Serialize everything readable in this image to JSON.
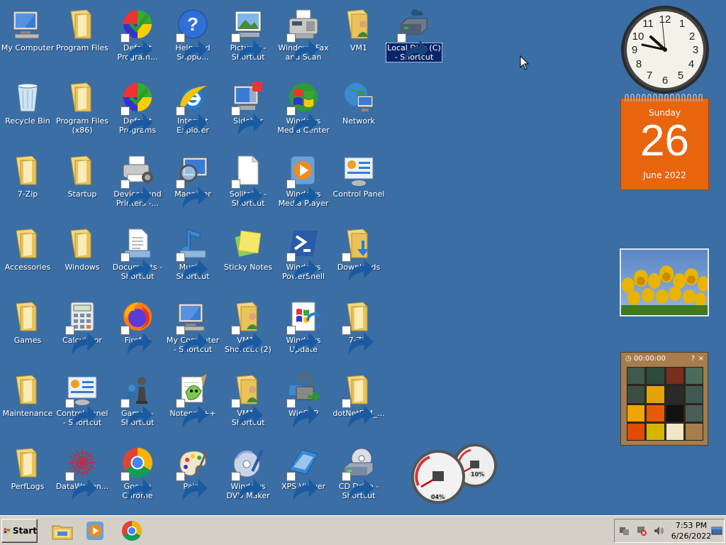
{
  "desktop": {
    "icons": [
      {
        "label": "My Computer",
        "icon": "computer-icon",
        "shortcut": false
      },
      {
        "label": "Program Files",
        "icon": "folder-icon",
        "shortcut": false
      },
      {
        "label": "Default Program...",
        "icon": "default-programs-icon",
        "shortcut": true
      },
      {
        "label": "Help and Suppo...",
        "icon": "help-icon",
        "shortcut": true
      },
      {
        "label": "Pictures - Shortcut",
        "icon": "pictures-icon",
        "shortcut": true
      },
      {
        "label": "Windows Fax and Scan",
        "icon": "fax-icon",
        "shortcut": true
      },
      {
        "label": "VM1",
        "icon": "user-folder-icon",
        "shortcut": false
      },
      {
        "label": "Local Disk (C) - Shortcut",
        "icon": "drive-icon",
        "shortcut": true,
        "selected": true
      },
      {
        "label": "Recycle Bin",
        "icon": "recycle-bin-icon",
        "shortcut": false
      },
      {
        "label": "Program Files (x86)",
        "icon": "folder-icon",
        "shortcut": false
      },
      {
        "label": "Default Programs",
        "icon": "default-programs-icon",
        "shortcut": true
      },
      {
        "label": "Internet Explorer",
        "icon": "internet-explorer-icon",
        "shortcut": true
      },
      {
        "label": "Sidebar",
        "icon": "sidebar-icon",
        "shortcut": true
      },
      {
        "label": "Windows Media Center",
        "icon": "media-center-icon",
        "shortcut": true
      },
      {
        "label": "Network",
        "icon": "network-icon",
        "shortcut": false
      },
      {
        "label": "7-Zip",
        "icon": "folder-icon",
        "shortcut": false
      },
      {
        "label": "Startup",
        "icon": "folder-icon",
        "shortcut": false
      },
      {
        "label": "Devices and Printers -...",
        "icon": "printer-icon",
        "shortcut": true
      },
      {
        "label": "Magnifier",
        "icon": "magnifier-icon",
        "shortcut": true
      },
      {
        "label": "Solitaire - Shortcut",
        "icon": "document-icon",
        "shortcut": true
      },
      {
        "label": "Windows Media Player",
        "icon": "media-player-icon",
        "shortcut": true
      },
      {
        "label": "Control Panel",
        "icon": "control-panel-icon",
        "shortcut": false
      },
      {
        "label": "Accessories",
        "icon": "folder-icon",
        "shortcut": false
      },
      {
        "label": "Windows",
        "icon": "folder-icon",
        "shortcut": false
      },
      {
        "label": "Documents - Shortcut",
        "icon": "documents-icon",
        "shortcut": true
      },
      {
        "label": "Music - Shortcut",
        "icon": "music-icon",
        "shortcut": true
      },
      {
        "label": "Sticky Notes",
        "icon": "sticky-notes-icon",
        "shortcut": false
      },
      {
        "label": "Windows PowerShell",
        "icon": "powershell-icon",
        "shortcut": true
      },
      {
        "label": "Downloads",
        "icon": "downloads-folder-icon",
        "shortcut": true
      },
      {
        "label": "Games",
        "icon": "folder-icon",
        "shortcut": false
      },
      {
        "label": "Calculator",
        "icon": "calculator-icon",
        "shortcut": true
      },
      {
        "label": "Firefox",
        "icon": "firefox-icon",
        "shortcut": true
      },
      {
        "label": "My Computer - Shortcut",
        "icon": "computer-icon",
        "shortcut": true
      },
      {
        "label": "VM1 - Shortcut (2)",
        "icon": "user-folder-icon",
        "shortcut": true
      },
      {
        "label": "Windows Update",
        "icon": "windows-update-icon",
        "shortcut": true
      },
      {
        "label": "7-Zip",
        "icon": "folder-icon",
        "shortcut": true
      },
      {
        "label": "Maintenance",
        "icon": "folder-icon",
        "shortcut": false
      },
      {
        "label": "Control Panel - Shortcut",
        "icon": "control-panel-icon",
        "shortcut": true
      },
      {
        "label": "Games - Shortcut",
        "icon": "games-icon",
        "shortcut": true
      },
      {
        "label": "Notepad++",
        "icon": "notepad-plus-plus-icon",
        "shortcut": true
      },
      {
        "label": "VM1 - Shortcut",
        "icon": "user-folder-icon",
        "shortcut": true
      },
      {
        "label": "WinSCP",
        "icon": "winscp-icon",
        "shortcut": true
      },
      {
        "label": "dotNetFx4_...",
        "icon": "folder-icon",
        "shortcut": true
      },
      {
        "label": "PerfLogs",
        "icon": "folder-icon",
        "shortcut": false
      },
      {
        "label": "DataWagon...",
        "icon": "datawagon-icon",
        "shortcut": true
      },
      {
        "label": "Google Chrome",
        "icon": "chrome-icon",
        "shortcut": true
      },
      {
        "label": "Paint",
        "icon": "paint-icon",
        "shortcut": true
      },
      {
        "label": "Windows DVD Maker",
        "icon": "dvd-maker-icon",
        "shortcut": true
      },
      {
        "label": "XPS Viewer",
        "icon": "xps-viewer-icon",
        "shortcut": true
      },
      {
        "label": "CD Drive - Shortcut",
        "icon": "cd-drive-icon",
        "shortcut": true
      }
    ]
  },
  "gadgets": {
    "calendar": {
      "day": "Sunday",
      "date": "26",
      "month": "June 2022"
    },
    "puzzle": {
      "timer": "00:00:00"
    },
    "cpu_meter": {
      "cpu": "04%",
      "memory": "10%"
    }
  },
  "taskbar": {
    "start_label": "Start",
    "quick_launch": [
      "explorer-icon",
      "media-player-icon",
      "chrome-icon"
    ],
    "tray": {
      "time": "7:53 PM",
      "date": "6/26/2022"
    }
  },
  "colors": {
    "desktop": "#3a6ea5",
    "taskbar": "#d4d0c8",
    "calendar": "#e8650e",
    "selection": "#0a246a"
  }
}
